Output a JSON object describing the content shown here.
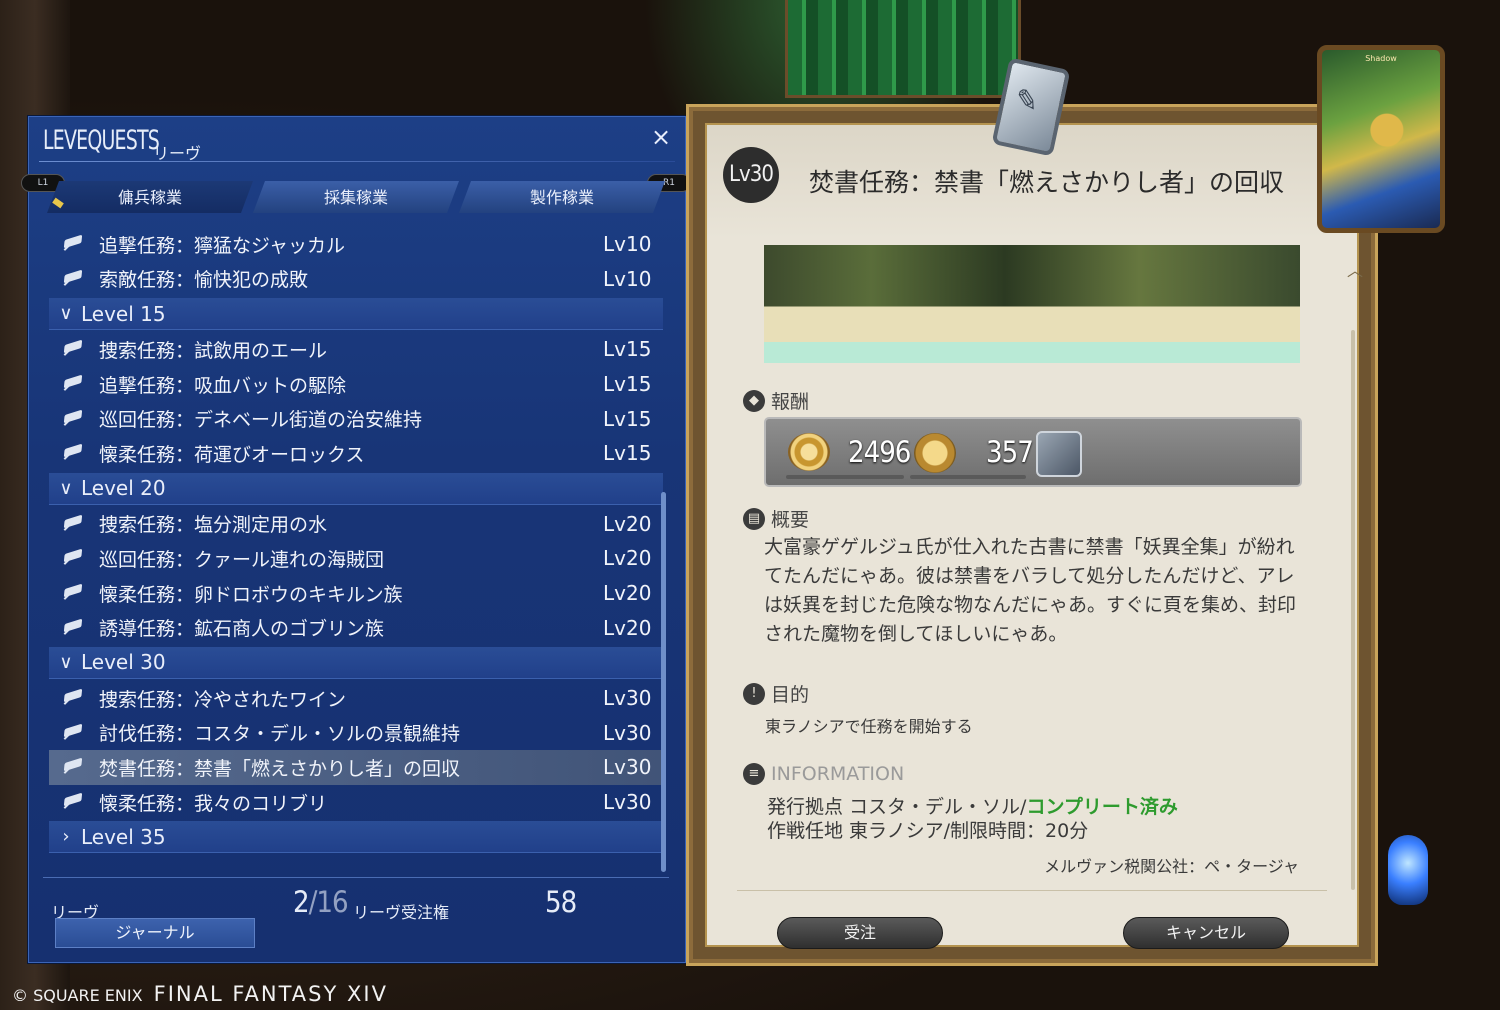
{
  "window": {
    "title_en": "LEVEQUESTS",
    "title_jp": "リーヴ",
    "close_label": "×"
  },
  "shoulders": {
    "left": "L1",
    "right": "R1"
  },
  "tabs": [
    {
      "label": "傭兵稼業"
    },
    {
      "label": "採集稼業"
    },
    {
      "label": "製作稼業"
    }
  ],
  "quests": {
    "pre": [
      {
        "name": "追撃任務：獰猛なジャッカル",
        "lv": "Lv10"
      },
      {
        "name": "索敵任務：愉快犯の成敗",
        "lv": "Lv10"
      }
    ],
    "group15": {
      "label": "Level 15",
      "chev": "∨"
    },
    "lv15": [
      {
        "name": "捜索任務：試飲用のエール",
        "lv": "Lv15"
      },
      {
        "name": "追撃任務：吸血バットの駆除",
        "lv": "Lv15"
      },
      {
        "name": "巡回任務：デネベール街道の治安維持",
        "lv": "Lv15"
      },
      {
        "name": "懐柔任務：荷運びオーロックス",
        "lv": "Lv15"
      }
    ],
    "group20": {
      "label": "Level 20",
      "chev": "∨"
    },
    "lv20": [
      {
        "name": "捜索任務：塩分測定用の水",
        "lv": "Lv20"
      },
      {
        "name": "巡回任務：クァール連れの海賊団",
        "lv": "Lv20"
      },
      {
        "name": "懐柔任務：卵ドロボウのキキルン族",
        "lv": "Lv20"
      },
      {
        "name": "誘導任務：鉱石商人のゴブリン族",
        "lv": "Lv20"
      }
    ],
    "group30": {
      "label": "Level 30",
      "chev": "∨"
    },
    "lv30": [
      {
        "name": "捜索任務：冷やされたワイン",
        "lv": "Lv30"
      },
      {
        "name": "討伐任務：コスタ・デル・ソルの景観維持",
        "lv": "Lv30"
      },
      {
        "name": "焚書任務：禁書「燃えさかりし者」の回収",
        "lv": "Lv30"
      },
      {
        "name": "懐柔任務：我々のコリブリ",
        "lv": "Lv30"
      }
    ],
    "group35": {
      "label": "Level 35",
      "chev": "›"
    }
  },
  "footer": {
    "leve_label": "リーヴ",
    "leve_count": "2",
    "leve_total": "/16",
    "allowance_label": "リーヴ受注権",
    "allowance": "58",
    "journal_button": "ジャーナル"
  },
  "detail": {
    "level": "Lv30",
    "title": "焚書任務：禁書「燃えさかりし者」の回収",
    "card_title": "Shadow",
    "reward_label": "報酬",
    "gil": "2496",
    "seals": "357",
    "summary_label": "概要",
    "summary": "大富豪ゲゲルジュ氏が仕入れた古書に禁書「妖異全集」が紛れてたんだにゃあ。彼は禁書をバラして処分したんだけど、アレは妖異を封じた危険な物なんだにゃあ。すぐに頁を集め、封印された魔物を倒してほしいにゃあ。",
    "objective_label": "目的",
    "objective": "東ラノシアで任務を開始する",
    "info_label": "INFORMATION",
    "issuer_prefix": "発行拠点 コスタ・デル・ソル/",
    "complete": "コンプリート済み",
    "location": "作戦任地 東ラノシア/制限時間：20分",
    "client": "メルヴァン税関公社：ペ・タージャ",
    "accept_button": "受注",
    "cancel_button": "キャンセル"
  },
  "copyright": {
    "company": "© SQUARE ENIX",
    "game": "FINAL FANTASY XIV"
  }
}
